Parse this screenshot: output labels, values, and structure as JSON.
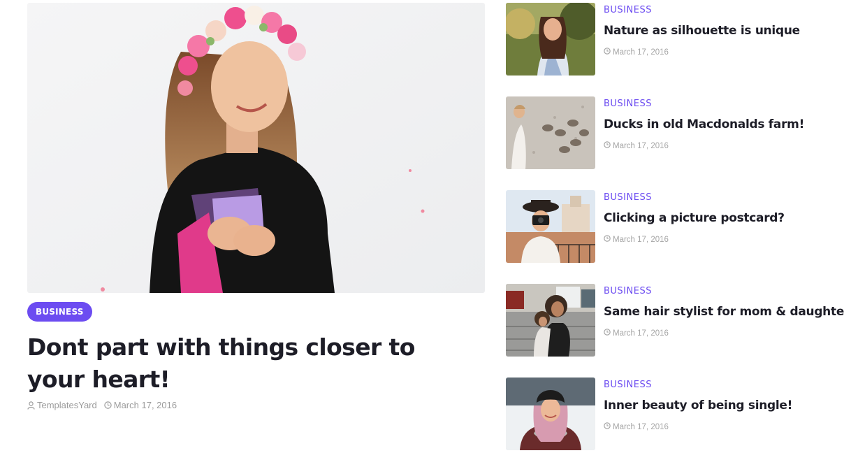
{
  "featured": {
    "category": "BUSINESS",
    "title": "Dont part with things closer to your heart!",
    "author": "TemplatesYard",
    "date": "March 17, 2016",
    "image": "woman-flower-crown-photo"
  },
  "side_posts": [
    {
      "category": "BUSINESS",
      "title": "Nature as silhouette is unique",
      "date": "March 17, 2016",
      "image": "woman-in-park-photo"
    },
    {
      "category": "BUSINESS",
      "title": "Ducks in old Macdonalds farm!",
      "date": "March 17, 2016",
      "image": "ducks-on-gravel-photo"
    },
    {
      "category": "BUSINESS",
      "title": "Clicking a picture postcard?",
      "date": "March 17, 2016",
      "image": "woman-with-camera-photo"
    },
    {
      "category": "BUSINESS",
      "title": "Same hair stylist for mom & daughter!",
      "date": "March 17, 2016",
      "image": "mom-and-daughter-photo"
    },
    {
      "category": "BUSINESS",
      "title": "Inner beauty of being single!",
      "date": "March 17, 2016",
      "image": "woman-winter-hat-photo"
    }
  ],
  "colors": {
    "accent": "#6c4cf1",
    "title": "#1d1d27",
    "meta": "#9b9b9b"
  },
  "icons": {
    "author": "user-icon",
    "date": "clock-icon"
  }
}
